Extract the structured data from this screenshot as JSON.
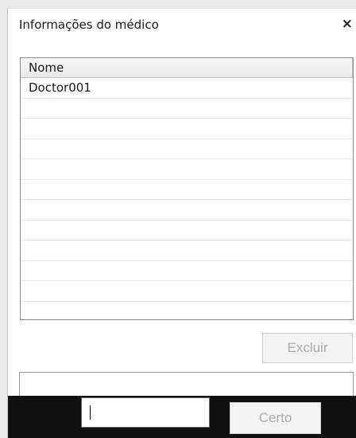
{
  "dialog": {
    "title": "Informações do médico",
    "close_glyph": "×"
  },
  "list": {
    "column_header": "Nome",
    "rows": [
      "Doctor001",
      "",
      "",
      "",
      "",
      "",
      "",
      "",
      "",
      "",
      "",
      ""
    ]
  },
  "buttons": {
    "delete_label": "Excluir",
    "ok_label": "Certo"
  },
  "input": {
    "value": ""
  }
}
